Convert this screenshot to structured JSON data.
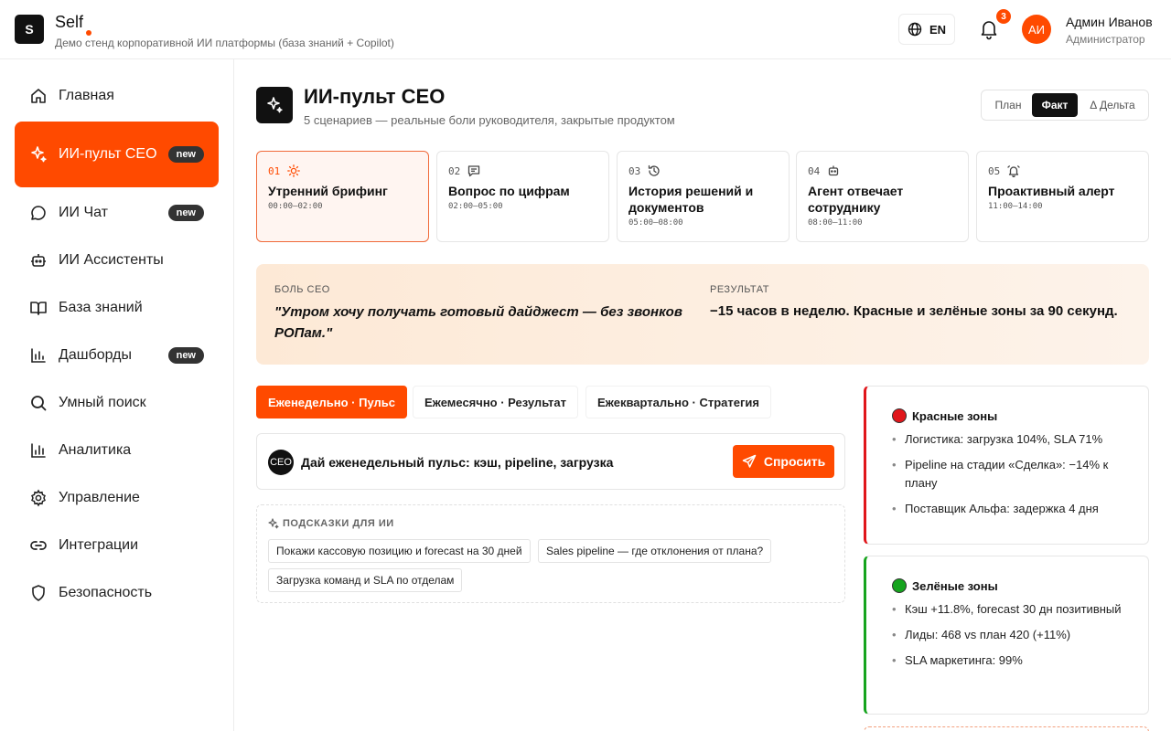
{
  "header": {
    "logo_letter": "S",
    "brand": "Self",
    "subtitle": "Демо стенд корпоративной ИИ платформы (база знаний + Copilot)",
    "lang": "EN",
    "notifications": "3",
    "avatar_initials": "АИ",
    "user_name": "Админ Иванов",
    "user_role": "Администратор",
    "accent": "#ff4a00"
  },
  "sidebar": {
    "items": [
      {
        "label": "Главная",
        "icon": "home-icon"
      },
      {
        "label": "ИИ-пульт CEO",
        "icon": "sparkle-icon",
        "badge": "new",
        "active": true
      },
      {
        "label": "ИИ Чат",
        "icon": "chat-icon",
        "badge": "new"
      },
      {
        "label": "ИИ Ассистенты",
        "icon": "bot-icon"
      },
      {
        "label": "База знаний",
        "icon": "book-icon"
      },
      {
        "label": "Дашборды",
        "icon": "chart-icon",
        "badge": "new"
      },
      {
        "label": "Умный поиск",
        "icon": "search-icon"
      },
      {
        "label": "Аналитика",
        "icon": "analytics-icon"
      },
      {
        "label": "Управление",
        "icon": "gear-icon"
      },
      {
        "label": "Интеграции",
        "icon": "link-icon"
      },
      {
        "label": "Безопасность",
        "icon": "shield-icon"
      }
    ]
  },
  "main": {
    "title": "ИИ-пульт CEO",
    "subtitle": "5 сценариев — реальные боли руководителя, закрытые продуктом",
    "toggle": [
      "План",
      "Факт",
      "Δ Дельта"
    ],
    "toggle_selected": "Факт",
    "scenarios": [
      {
        "num": "01",
        "name": "Утренний брифинг",
        "time": "00:00–02:00",
        "icon": "sun-icon"
      },
      {
        "num": "02",
        "name": "Вопрос по цифрам",
        "time": "02:00–05:00",
        "icon": "message-icon"
      },
      {
        "num": "03",
        "name": "История решений и документов",
        "time": "05:00–08:00",
        "icon": "history-icon"
      },
      {
        "num": "04",
        "name": "Агент отвечает сотруднику",
        "time": "08:00–11:00",
        "icon": "bot-icon"
      },
      {
        "num": "05",
        "name": "Проактивный алерт",
        "time": "11:00–14:00",
        "icon": "bell-alert-icon"
      }
    ],
    "pain_label": "БОЛЬ CEO",
    "pain_quote": "\"Утром хочу получать готовый дайджест — без звонков РОПам.\"",
    "result_label": "РЕЗУЛЬТАТ",
    "result_text": "−15 часов в неделю. Красные и зелёные зоны за 90 секунд.",
    "tabs": [
      "Еженедельно · Пульс",
      "Ежемесячно · Результат",
      "Ежеквартально · Стратегия"
    ],
    "ask_avatar": "CEO",
    "ask_text": "Дай еженедельный пульс: кэш, pipeline, загрузка",
    "ask_button": "Спросить",
    "hints_title": "ПОДСКАЗКИ ДЛЯ ИИ",
    "hints": [
      "Покажи кассовую позицию и forecast на 30 дней",
      "Sales pipeline — где отклонения от плана?",
      "Загрузка команд и SLA по отделам"
    ]
  },
  "zones": {
    "red": {
      "title": "Красные зоны",
      "color": "#e0161b",
      "items": [
        "Логистика: загрузка 104%, SLA 71%",
        "Pipeline на стадии «Сделка»: −14% к плану",
        "Поставщик Альфа: задержка 4 дня"
      ]
    },
    "green": {
      "title": "Зелёные зоны",
      "color": "#16a41e",
      "items": [
        "Кэш +11.8%, forecast 30 дн позитивный",
        "Лиды: 468 vs план 420 (+11%)",
        "SLA маркетинга: 99%"
      ]
    }
  }
}
